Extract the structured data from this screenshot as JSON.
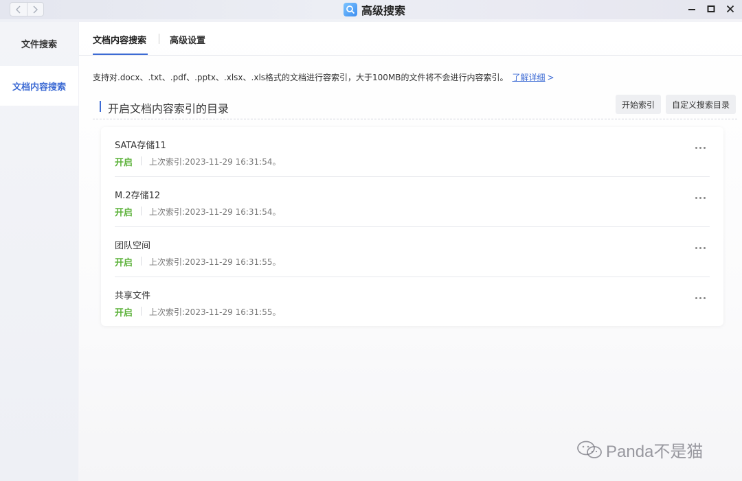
{
  "window": {
    "title": "高级搜索",
    "nav_back": "<",
    "nav_forward": ">"
  },
  "sidebar": {
    "items": [
      {
        "label": "文件搜索"
      },
      {
        "label": "文档内容搜索"
      }
    ]
  },
  "tabs": [
    {
      "label": "文档内容搜索"
    },
    {
      "label": "高级设置"
    }
  ],
  "info": {
    "text": "支持对.docx、.txt、.pdf、.pptx、.xlsx、.xls格式的文档进行容索引，大于100MB的文件将不会进行内容索引。",
    "link": "了解详细",
    "chevron": ">"
  },
  "section": {
    "title": "开启文档内容索引的目录",
    "start_button": "开始索引",
    "custom_button": "自定义搜索目录"
  },
  "directories": [
    {
      "name": "SATA存储11",
      "status": "开启",
      "last_index": "上次索引:2023-11-29 16:31:54。"
    },
    {
      "name": "M.2存储12",
      "status": "开启",
      "last_index": "上次索引:2023-11-29 16:31:54。"
    },
    {
      "name": "团队空间",
      "status": "开启",
      "last_index": "上次索引:2023-11-29 16:31:55。"
    },
    {
      "name": "共享文件",
      "status": "开启",
      "last_index": "上次索引:2023-11-29 16:31:55。"
    }
  ],
  "watermark": {
    "text": "Panda不是猫"
  },
  "colors": {
    "accent": "#3d6bd4",
    "status_on": "#5cb23a"
  }
}
